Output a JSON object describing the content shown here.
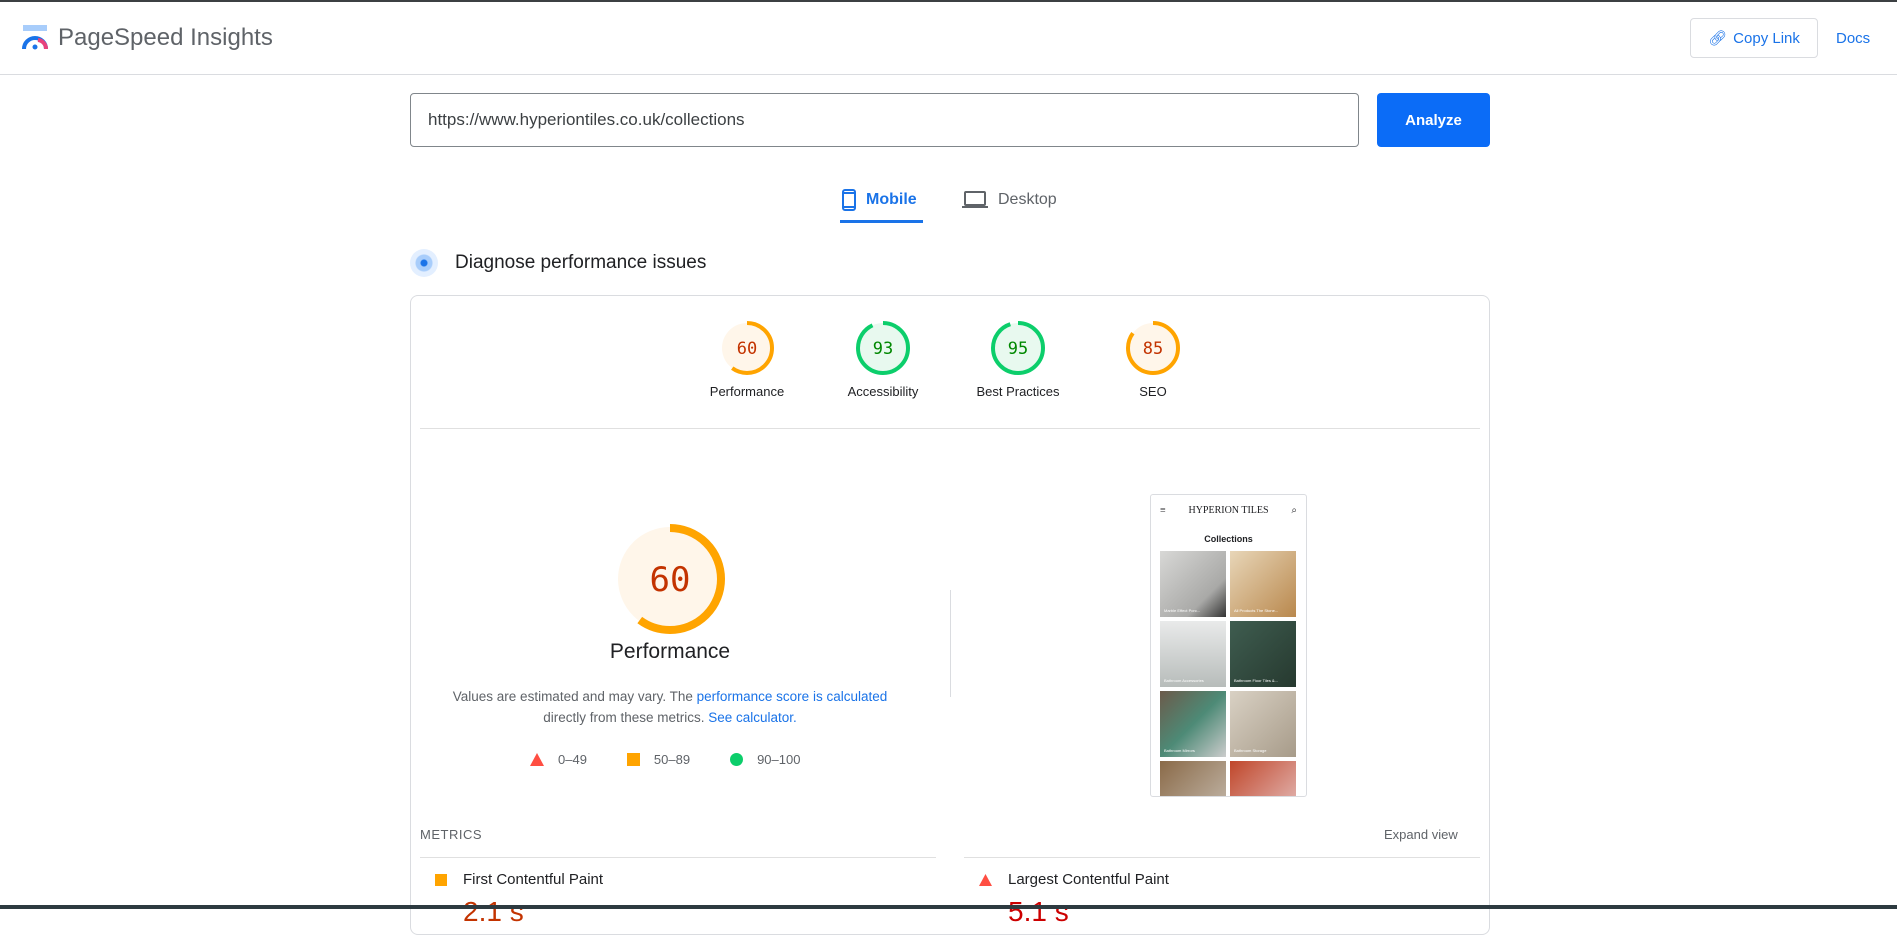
{
  "header": {
    "title": "PageSpeed Insights",
    "copy_link": "Copy Link",
    "docs": "Docs"
  },
  "search": {
    "url": "https://www.hyperiontiles.co.uk/collections",
    "analyze": "Analyze"
  },
  "tabs": [
    {
      "label": "Mobile",
      "active": true
    },
    {
      "label": "Desktop",
      "active": false
    }
  ],
  "section_title": "Diagnose performance issues",
  "scores": [
    {
      "label": "Performance",
      "value": 60,
      "status": "average"
    },
    {
      "label": "Accessibility",
      "value": 93,
      "status": "pass"
    },
    {
      "label": "Best Practices",
      "value": 95,
      "status": "pass"
    },
    {
      "label": "SEO",
      "value": 85,
      "status": "average"
    }
  ],
  "main_score": {
    "value": "60",
    "label": "Performance",
    "desc_1": "Values are estimated and may vary. The ",
    "link_1": "performance score is calculated",
    "desc_2": " directly from these metrics. ",
    "link_2": "See calculator."
  },
  "legend": [
    {
      "range": "0–49",
      "icon": "triangle-icon"
    },
    {
      "range": "50–89",
      "icon": "square-icon"
    },
    {
      "range": "90–100",
      "icon": "circle-icon"
    }
  ],
  "thumbnail": {
    "brand": "HYPERION TILES",
    "heading": "Collections",
    "tiles": [
      "Marble Effect Porc...",
      "All Products The Stone...",
      "Bathroom Accessories",
      "Bathroom Floor Tiles &...",
      "Bathroom Mirrors",
      "Bathroom Storage",
      "",
      ""
    ]
  },
  "metrics": {
    "heading": "METRICS",
    "expand": "Expand view",
    "items": [
      {
        "name": "First Contentful Paint",
        "value": "2.1 s",
        "status": "average"
      },
      {
        "name": "Largest Contentful Paint",
        "value": "5.1 s",
        "status": "fail"
      }
    ]
  },
  "colors": {
    "accent": "#1a73e8",
    "analyze": "#0b6cf7",
    "pass": "#0cce6b",
    "average": "#ffa400",
    "fail": "#ff4e42",
    "pass_text": "#008800",
    "average_text": "#c33300"
  }
}
